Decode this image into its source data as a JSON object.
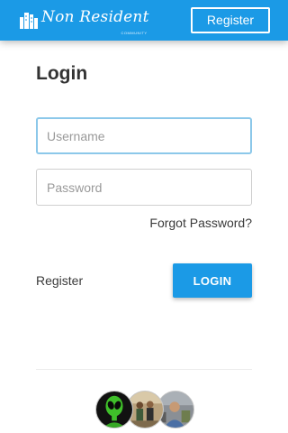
{
  "header": {
    "logo_text": "Non Resident",
    "logo_subtext": "COMMUNITY",
    "register_label": "Register"
  },
  "login": {
    "title": "Login",
    "username_placeholder": "Username",
    "password_placeholder": "Password",
    "forgot_label": "Forgot Password?",
    "register_label": "Register",
    "login_label": "LOGIN"
  },
  "avatars": [
    {
      "icon": "alien-avatar"
    },
    {
      "icon": "people-photo-avatar"
    },
    {
      "icon": "person-photo-avatar"
    }
  ],
  "colors": {
    "accent": "#1b9ae6",
    "focus_border": "#8cc8ea",
    "text_dark": "#333333"
  }
}
